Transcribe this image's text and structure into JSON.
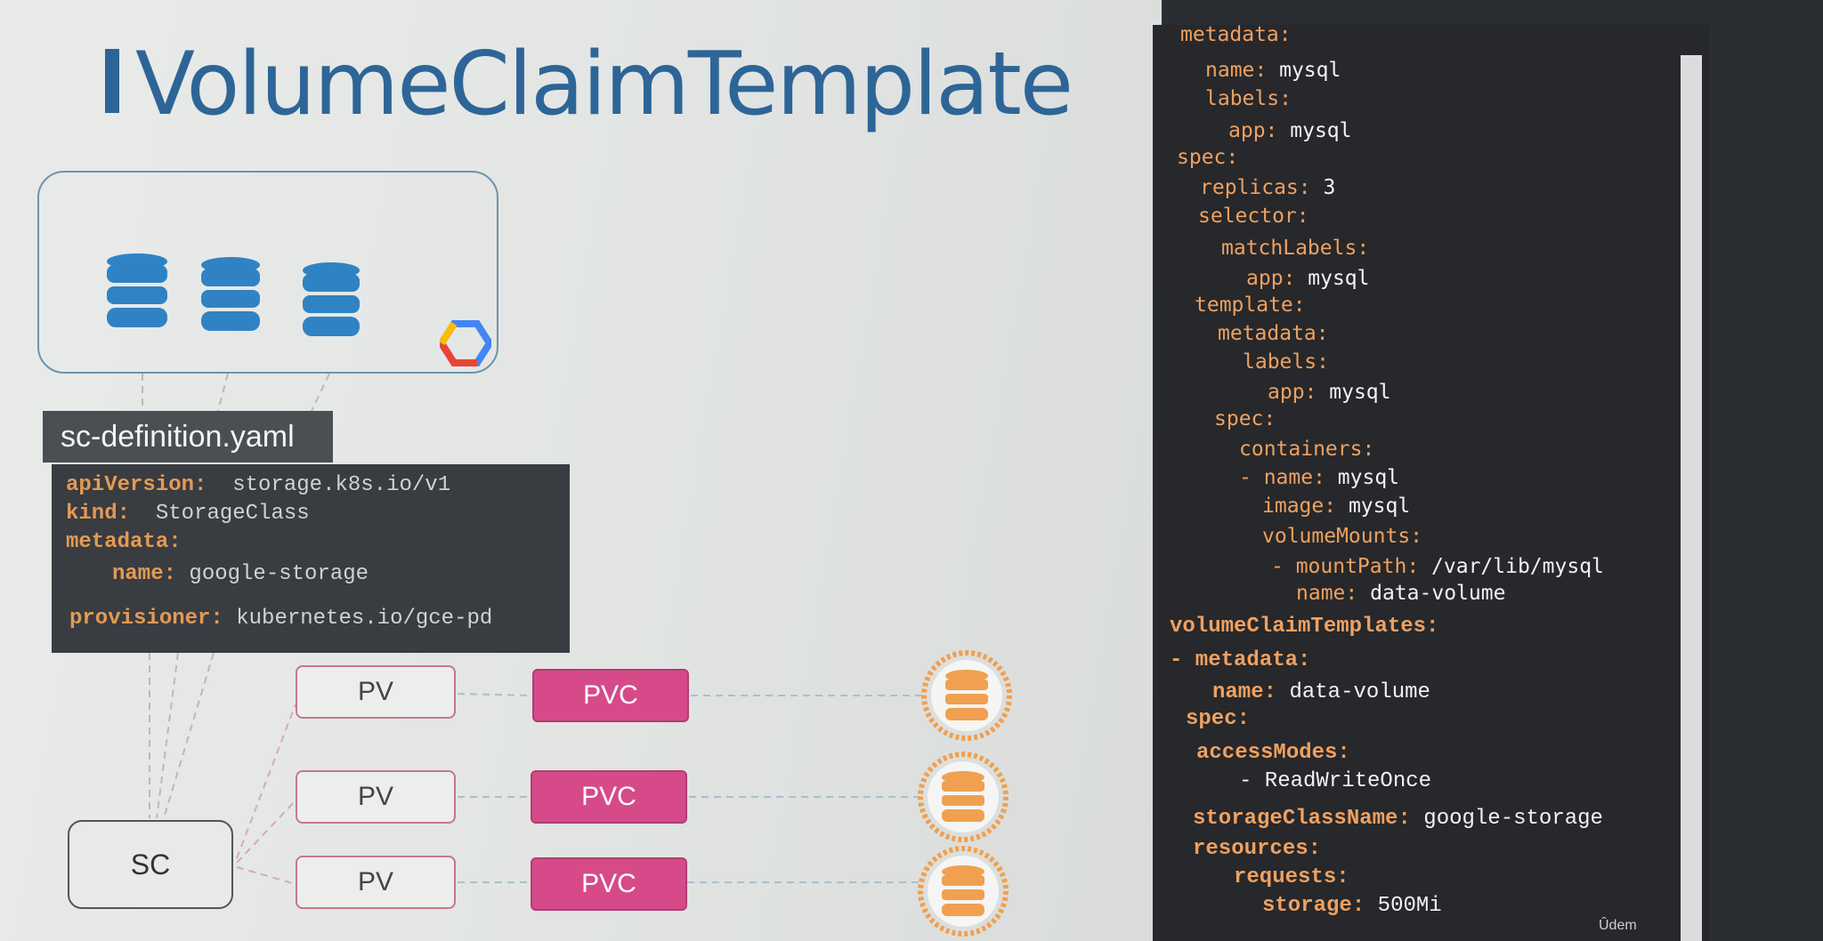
{
  "slide": {
    "title": "VolumeClaimTemplate",
    "yaml_tab": "sc-definition.yaml",
    "yaml_lines": [
      {
        "key": "apiVersion:",
        "value": "storage.k8s.io/v1"
      },
      {
        "key": "kind:",
        "value": "StorageClass"
      },
      {
        "key": "metadata:",
        "value": ""
      },
      {
        "key": "name:",
        "value": "google-storage"
      },
      {
        "key": "provisioner:",
        "value": "kubernetes.io/gce-pd"
      }
    ],
    "rows": [
      {
        "pv": "PV",
        "pvc": "PVC"
      },
      {
        "pv": "PV",
        "pvc": "PVC"
      },
      {
        "pv": "PV",
        "pvc": "PVC"
      }
    ],
    "sc": "SC"
  },
  "code": {
    "lines": [
      {
        "key": "metadata:",
        "value": ""
      },
      {
        "key": "name:",
        "value": "mysql"
      },
      {
        "key": "labels:",
        "value": ""
      },
      {
        "key": "app:",
        "value": "mysql"
      },
      {
        "key": "spec:",
        "value": ""
      },
      {
        "key": "replicas:",
        "value": "3"
      },
      {
        "key": "selector:",
        "value": ""
      },
      {
        "key": "matchLabels:",
        "value": ""
      },
      {
        "key": "app:",
        "value": "mysql"
      },
      {
        "key": "template:",
        "value": ""
      },
      {
        "key": "metadata:",
        "value": ""
      },
      {
        "key": "labels:",
        "value": ""
      },
      {
        "key": "app:",
        "value": "mysql"
      },
      {
        "key": "spec:",
        "value": ""
      },
      {
        "key": "containers:",
        "value": ""
      },
      {
        "key": "- name:",
        "value": "mysql"
      },
      {
        "key": "image:",
        "value": "mysql"
      },
      {
        "key": "volumeMounts:",
        "value": ""
      },
      {
        "key": "- mountPath:",
        "value": "/var/lib/mysql"
      },
      {
        "key": "name:",
        "value": "data-volume"
      },
      {
        "key": "volumeClaimTemplates:",
        "value": ""
      },
      {
        "key": "- metadata:",
        "value": ""
      },
      {
        "key": "name:",
        "value": "data-volume"
      },
      {
        "key": "spec:",
        "value": ""
      },
      {
        "key": "accessModes:",
        "value": ""
      },
      {
        "key": "- ReadWriteOnce",
        "value": ""
      },
      {
        "key": "storageClassName:",
        "value": "google-storage"
      },
      {
        "key": "resources:",
        "value": ""
      },
      {
        "key": "requests:",
        "value": ""
      },
      {
        "key": "storage:",
        "value": "500Mi"
      }
    ],
    "watermark": "Ûdem"
  },
  "colors": {
    "title": "#2e6597",
    "pvc": "#d64a8a",
    "disk": "#f0a050",
    "db": "#2f83c4",
    "code_key": "#f0a060"
  }
}
